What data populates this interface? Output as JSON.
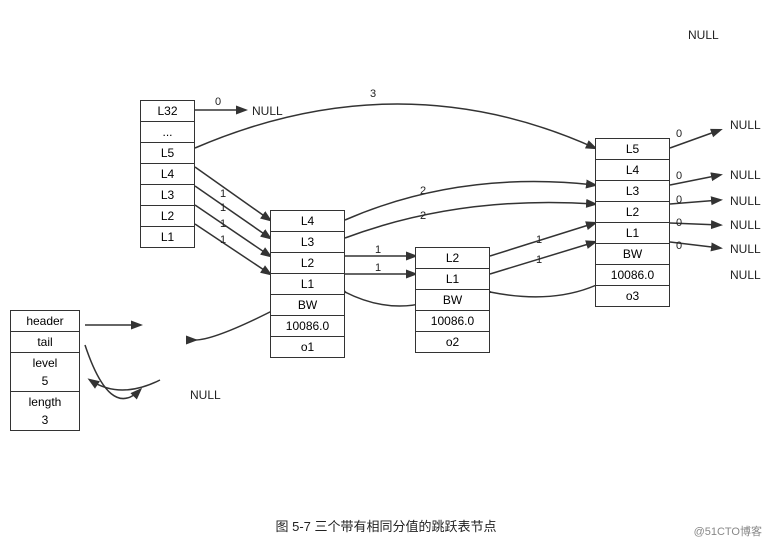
{
  "caption": "图 5-7   三个带有相同分值的跳跃表节点",
  "watermark": "@51CTO博客",
  "nodes": {
    "header": {
      "label": "header/tail/level5/length3",
      "cells": [
        "header",
        "tail",
        "level\n5",
        "length\n3"
      ]
    },
    "node_left": {
      "cells": [
        "L32",
        "...",
        "L5",
        "L4",
        "L3",
        "L2",
        "L1"
      ]
    },
    "node_o1": {
      "cells": [
        "L4",
        "L3",
        "L2",
        "L1",
        "BW",
        "10086.0",
        "o1"
      ]
    },
    "node_o2": {
      "cells": [
        "L2",
        "L1",
        "BW",
        "10086.0",
        "o2"
      ]
    },
    "node_o3": {
      "cells": [
        "L5",
        "L4",
        "L3",
        "L2",
        "L1",
        "BW",
        "10086.0",
        "o3"
      ]
    }
  },
  "nulls": [
    "NULL (top-right top)",
    "NULL (top-right 2)",
    "NULL (right L4)",
    "NULL (right L3)",
    "NULL (right L2)",
    "NULL (bottom-right)",
    "NULL (left L1 back)"
  ],
  "numbers": {
    "arrow_labels": [
      "0",
      "3",
      "2",
      "2",
      "1",
      "1",
      "1",
      "1",
      "1",
      "1",
      "0",
      "0",
      "0",
      "0",
      "0"
    ]
  }
}
